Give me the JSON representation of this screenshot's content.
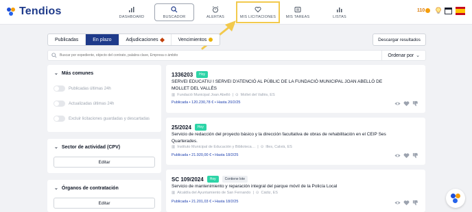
{
  "app": {
    "name": "Tendios"
  },
  "nav": [
    {
      "label": "DASHBOARD",
      "icon": "bar-chart-icon"
    },
    {
      "label": "BUSCADOR",
      "icon": "search-icon"
    },
    {
      "label": "ALERTAS",
      "icon": "alarm-clock-icon"
    },
    {
      "label": "MIS LICITACIONES",
      "icon": "heart-icon"
    },
    {
      "label": "MIS TAREAS",
      "icon": "tasks-icon"
    },
    {
      "label": "LISTAS",
      "icon": "list-chart-icon"
    }
  ],
  "topright": {
    "coins": "110"
  },
  "tabs": [
    "Publicadas",
    "En plazo",
    "Adjudicaciones",
    "Vencimientos"
  ],
  "download_label": "Descargar resultados",
  "search": {
    "placeholder": "Buscar por expediente, objecto del contrato, palabra clave, Empresa o ámbito",
    "order_label": "Ordenar por"
  },
  "sidebar": {
    "common": {
      "title": "Más comunes",
      "toggles": [
        "Publicadas últimas 24h",
        "Actualizadas últimas 24h",
        "Excluir licitaciones guardadas y descartadas"
      ]
    },
    "sector": {
      "title": "Sector de actividad (CPV)",
      "button": "Editar"
    },
    "organos": {
      "title": "Órganos de contratación",
      "button": "Editar"
    }
  },
  "cards": [
    {
      "id": "1336203",
      "badges": [
        "Hoy"
      ],
      "title": "SERVEI EDUCATIU I SERVEI D'ATENCIÓ AL PÚBLIC DE LA FUNDACIÓ MUNICIPAL JOAN ABELLÓ DE MOLLET DEL VALLÈS",
      "org": "Fundació Municipal Joan Abelló",
      "location": "Mollet del Vallès, ES",
      "status": "Publicada • 120.230,78 € • Hasta 20/2/25"
    },
    {
      "id": "25/2024",
      "badges": [
        "Hoy"
      ],
      "title": "Servicio de redacción del proyecto básico y la dirección facultativa de obras de rehabilitación en el CEIP Ses Quarterades.",
      "org": "Instituto Municipal de Educación y Biblioteca…",
      "location": "Illes, Calvià, ES",
      "status": "Publicada • 21.920,00 € • Hasta 18/2/25"
    },
    {
      "id": "SC 109/2024",
      "badges": [
        "Hoy",
        "Contiene lote"
      ],
      "title": "Servicio de mantenimiento y reparación integral del parque móvil de la Policía Local",
      "org": "Alcaldía del Ayuntamiento de San Fernando",
      "location": "Cádiz, ES",
      "status": "Publicada • 21.201,03 € • Hasta 18/2/25"
    }
  ],
  "colors": {
    "brand": "#1e3a8a",
    "accent": "#f2c94c",
    "badge": "#2dd4a7"
  }
}
